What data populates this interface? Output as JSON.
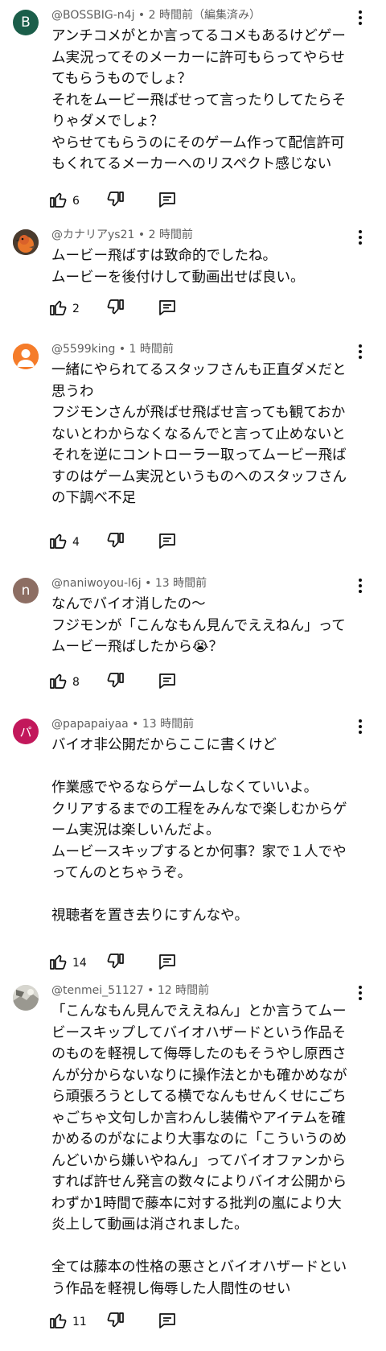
{
  "colors": {
    "text": "#0f0f0f",
    "meta": "#606060",
    "thread_line": "#e5e5e5"
  },
  "comments": [
    {
      "avatar_letter": "B",
      "avatar_color": "#1b5e4a",
      "avatar_kind": "letter",
      "author": "@BOSSBIG-n4j",
      "meta": " • 2 時間前（編集済み）",
      "lines": [
        "アンチコメがとか言ってるコメもあるけどゲー",
        "ム実況ってそのメーカーに許可もらってやらせ",
        "てもらうものでしょ？",
        "それをムービー飛ばせって言ったりしてたらそ",
        "りゃダメでしょ？",
        "やらせてもらうのにそのゲーム作って配信許可",
        "もくれてるメーカーへのリスペクト感じない"
      ],
      "likes": "6"
    },
    {
      "avatar_kind": "bird",
      "author": "@カナリアys21",
      "meta": " • 2 時間前",
      "lines": [
        "ムービー飛ばすは致命的でしたね。",
        "ムービーを後付けして動画出せば良い。"
      ],
      "likes": "2"
    },
    {
      "avatar_kind": "person",
      "avatar_color": "#f57c2a",
      "author": "@5599king",
      "meta": " • 1 時間前",
      "lines": [
        "一緒にやられてるスタッフさんも正直ダメだと",
        "思うわ",
        "フジモンさんが飛ばせ飛ばせ言っても観ておか",
        "ないとわからなくなるんでと言って止めないと",
        "それを逆にコントローラー取ってムービー飛ば",
        "すのはゲーム実況というものへのスタッフさん",
        "の下調べ不足"
      ],
      "likes": "4"
    },
    {
      "avatar_letter": "n",
      "avatar_color": "#8d6e63",
      "avatar_kind": "letter",
      "author": "@naniwoyou-l6j",
      "meta": " • 13 時間前",
      "lines": [
        "なんでバイオ消したの～",
        "フジモンが「こんなもん見んでええねん」って",
        "ムービー飛ばしたから😭？"
      ],
      "likes": "8"
    },
    {
      "avatar_letter": "パ",
      "avatar_color": "#c2185b",
      "avatar_kind": "letter",
      "author": "@papapaiyaa",
      "meta": " • 13 時間前",
      "lines": [
        "バイオ非公開だからここに書くけど",
        "",
        "作業感でやるならゲームしなくていいよ。",
        "クリアするまでの工程をみんなで楽しむからゲ",
        "ーム実況は楽しいんだよ。",
        "ムービースキップするとか何事？家で１人でや",
        "ってんのとちゃうぞ。",
        "",
        "視聴者を置き去りにすんなや。"
      ],
      "likes": "14"
    },
    {
      "avatar_kind": "photo",
      "author": "@tenmei_51127",
      "meta": " • 12 時間前",
      "lines": [
        "「こんなもん見んでええねん」とか言うてムー",
        "ビースキップしてバイオハザードという作品そ",
        "のものを軽視して侮辱したのもそうやし原西さ",
        "んが分からないなりに操作法とかも確かめなが",
        "ら頑張ろうとしてる横でなんもせんくせにごち",
        "ゃごちゃ文句しか言わんし装備やアイテムを確",
        "かめるのがなにより大事なのに「こういうのめ",
        "んどいから嫌いやねん」ってバイオファンから",
        "すれば許せん発言の数々によりバイオ公開から",
        "わずか1時間で藤本に対する批判の嵐により大",
        "炎上して動画は消されました。",
        "",
        "全ては藤本の性格の悪さとバイオハザードとい",
        "う作品を軽視し侮辱した人間性のせい"
      ],
      "likes": "11"
    }
  ]
}
